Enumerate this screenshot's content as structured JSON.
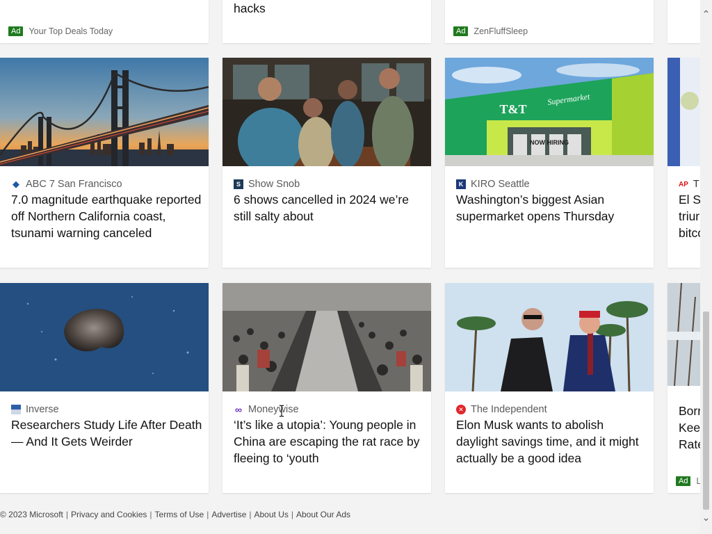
{
  "top_row": {
    "left": {
      "ad_label": "Ad",
      "advertiser": "Your Top Deals Today"
    },
    "middle": {
      "title_tail": "hacks"
    },
    "right": {
      "ad_label": "Ad",
      "advertiser": "ZenFluffSleep"
    }
  },
  "row1": [
    {
      "source": "ABC 7 San Francisco",
      "title": "7.0 magnitude earthquake reported off Northern California coast, tsunami warning canceled",
      "logo_icon": "abc7-logo-icon"
    },
    {
      "source": "Show Snob",
      "title": "6 shows cancelled in 2024 we’re still salty about",
      "logo_icon": "showsnob-logo-icon"
    },
    {
      "source": "KIRO Seattle",
      "title": "Washington’s biggest Asian supermarket opens Thursday",
      "logo_icon": "kiro-logo-icon"
    },
    {
      "source": "AP",
      "source_partial": "T",
      "title_lines": [
        "El Sa",
        "triur",
        "bitco"
      ],
      "logo_icon": "ap-logo-icon"
    }
  ],
  "row1_images": {
    "store_sign": "T&T",
    "store_sign_script": "Supermarket",
    "store_banner": "NOW HIRING"
  },
  "row2": [
    {
      "source": "Inverse",
      "title": "Researchers Study Life After Death — And It Gets Weirder",
      "logo_icon": "inverse-logo-icon"
    },
    {
      "source": "Moneywise",
      "title": "‘It’s like a utopia’: Young people in China are escaping the rat race by fleeing to ‘youth",
      "logo_icon": "moneywise-logo-icon"
    },
    {
      "source": "The Independent",
      "title": "Elon Musk wants to abolish daylight savings time, and it might actually be a good idea",
      "logo_icon": "independent-logo-icon"
    },
    {
      "title_lines": [
        "Borr",
        "Kee",
        "Rate"
      ],
      "ad_label": "Ad",
      "advertiser_partial": "L"
    }
  ],
  "footer": {
    "copyright": "© 2023 Microsoft",
    "links": [
      "Privacy and Cookies",
      "Terms of Use",
      "Advertise",
      "About Us",
      "About Our Ads"
    ],
    "separator": "|"
  },
  "scrollbar": {
    "up_icon": "chevron-up-icon",
    "down_icon": "chevron-down-icon"
  }
}
